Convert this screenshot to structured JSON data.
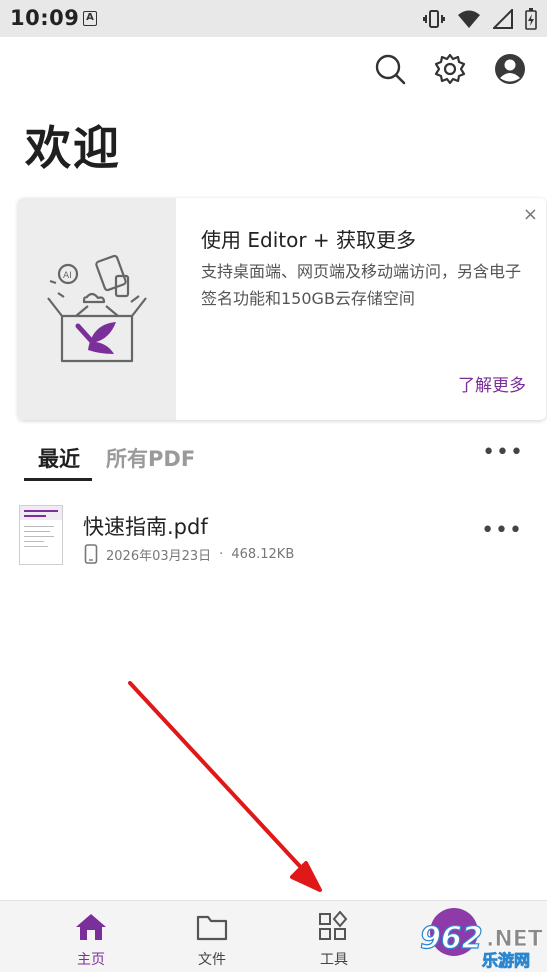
{
  "status_bar": {
    "time": "10:09",
    "a_icon_label": "A"
  },
  "header": {
    "title": "欢迎"
  },
  "promo": {
    "title": "使用 Editor + 获取更多",
    "description": "支持桌面端、网页端及移动端访问，另含电子签名功能和150GB云存储空间",
    "link": "了解更多",
    "close": "×"
  },
  "tabs": {
    "recent": "最近",
    "all_pdf": "所有PDF",
    "more": "•••"
  },
  "files": [
    {
      "name": "快速指南.pdf",
      "date": "2026年03月23日",
      "separator": "·",
      "size": "468.12KB"
    }
  ],
  "bottom_nav": {
    "home": "主页",
    "files": "文件",
    "tools": "工具"
  },
  "watermark": {
    "number": "962",
    "domain": ".NET",
    "site": "乐游网"
  },
  "colors": {
    "accent": "#7a2f9a",
    "arrow": "#e01818"
  }
}
